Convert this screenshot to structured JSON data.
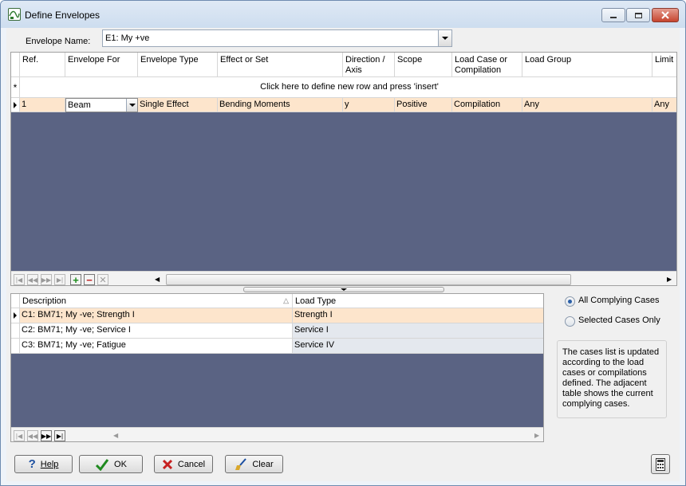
{
  "window": {
    "title": "Define Envelopes"
  },
  "envelope": {
    "label": "Envelope Name:",
    "value": "E1: My +ve"
  },
  "top_grid": {
    "columns": [
      "Ref.",
      "Envelope For",
      "Envelope Type",
      "Effect or Set",
      "Direction / Axis",
      "Scope",
      "Load Case or Compilation",
      "Load Group",
      "Limit S"
    ],
    "new_row_text": "Click here to define new row and press 'insert'",
    "new_row_marker": "*",
    "rows": [
      {
        "ref": "1",
        "envelope_for": "Beam",
        "envelope_type": "Single Effect",
        "effect": "Bending Moments",
        "direction": "y",
        "scope": "Positive",
        "load_case": "Compilation",
        "load_group": "Any",
        "limit": "Any"
      }
    ]
  },
  "bottom_grid": {
    "columns": [
      "Description",
      "Load Type"
    ],
    "rows": [
      {
        "description": "C1: BM71; My -ve; Strength I",
        "load_type": "Strength I"
      },
      {
        "description": "C2: BM71; My -ve; Service I",
        "load_type": "Service  I"
      },
      {
        "description": "C3: BM71; My -ve; Fatigue",
        "load_type": "Service  IV"
      }
    ]
  },
  "options": {
    "all_complying": "All Complying Cases",
    "selected_only": "Selected Cases Only",
    "selected": "all"
  },
  "info_text": "The cases list is updated according to the load cases or compilations defined.  The adjacent table shows the current complying cases.",
  "buttons": {
    "help": "Help",
    "ok": "OK",
    "cancel": "Cancel",
    "clear": "Clear"
  },
  "colors": {
    "grid_background": "#5a6383",
    "selected_row": "#fde5cc",
    "titlebar": "#d6e3f2"
  }
}
